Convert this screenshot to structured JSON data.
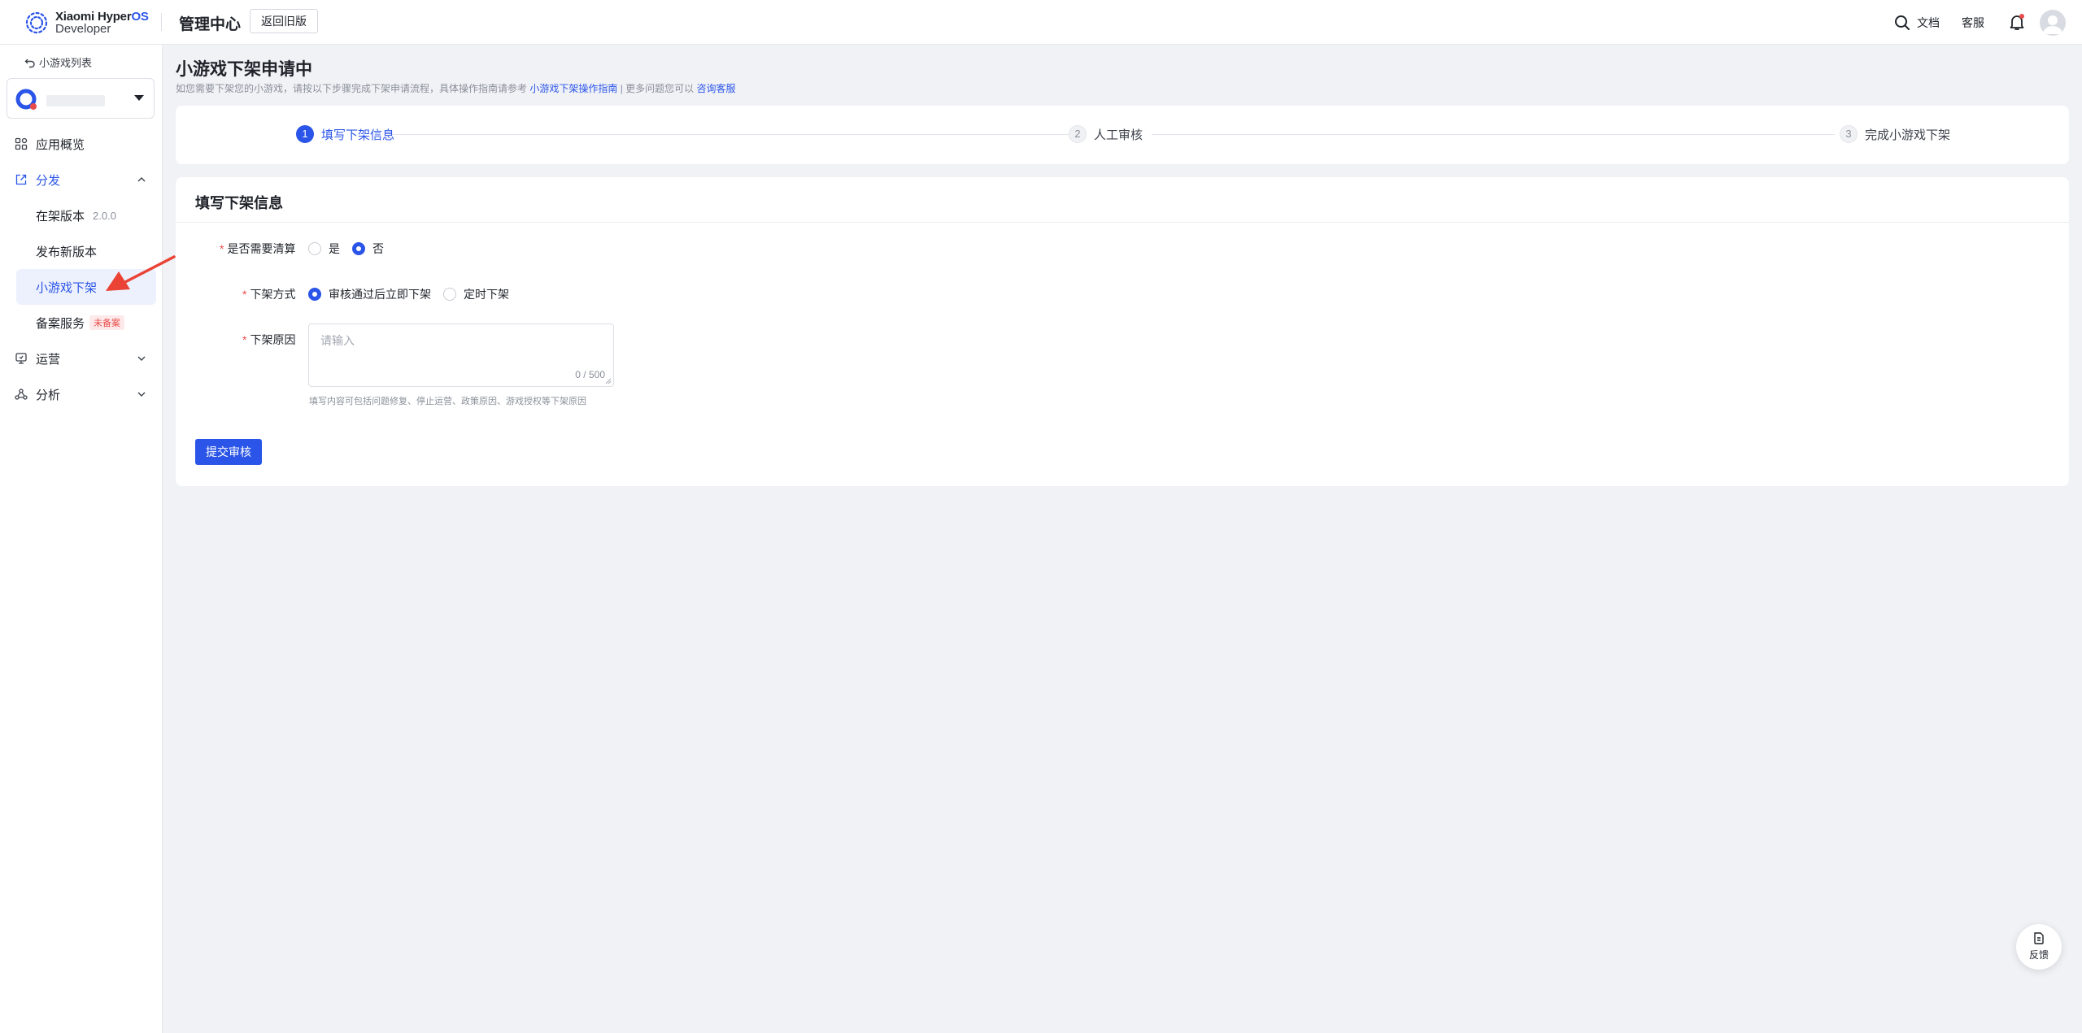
{
  "header": {
    "brand_line1": "Xiaomi Hyper",
    "brand_os": "OS",
    "brand_line2": "Developer",
    "title": "管理中心",
    "old_version_button": "返回旧版",
    "docs": "文档",
    "service": "客服"
  },
  "sidebar": {
    "back_label": "小游戏列表",
    "items": [
      {
        "label": "应用概览",
        "icon": "grid-icon"
      },
      {
        "label": "分发",
        "icon": "share-icon"
      },
      {
        "label": "在架版本",
        "version": "2.0.0"
      },
      {
        "label": "发布新版本"
      },
      {
        "label": "小游戏下架"
      },
      {
        "label": "备案服务",
        "tag": "未备案"
      },
      {
        "label": "运营",
        "icon": "operation-icon"
      },
      {
        "label": "分析",
        "icon": "analysis-icon"
      }
    ]
  },
  "page": {
    "title": "小游戏下架申请中",
    "desc_prefix": "如您需要下架您的小游戏，请按以下步骤完成下架申请流程，具体操作指南请参考",
    "desc_link1": "小游戏下架操作指南",
    "desc_mid": "| 更多问题您可以",
    "desc_link2": "咨询客服"
  },
  "steps": [
    {
      "num": "1",
      "label": "填写下架信息",
      "status": "current"
    },
    {
      "num": "2",
      "label": "人工审核",
      "status": "pending"
    },
    {
      "num": "3",
      "label": "完成小游戏下架",
      "status": "pending"
    }
  ],
  "form": {
    "section_title": "填写下架信息",
    "clear_label": "是否需要清算",
    "clear_options": [
      "是",
      "否"
    ],
    "clear_selected": "否",
    "method_label": "下架方式",
    "method_options": [
      "审核通过后立即下架",
      "定时下架"
    ],
    "method_selected": "审核通过后立即下架",
    "reason_label": "下架原因",
    "reason_placeholder": "请输入",
    "reason_count": "0 / 500",
    "reason_help": "填写内容可包括问题修复、停止运营、政策原因、游戏授权等下架原因",
    "submit": "提交审核"
  },
  "feedback": {
    "label": "反馈"
  },
  "colors": {
    "primary": "#2b55e8",
    "danger": "#e94b4b",
    "background": "#f1f2f6"
  }
}
